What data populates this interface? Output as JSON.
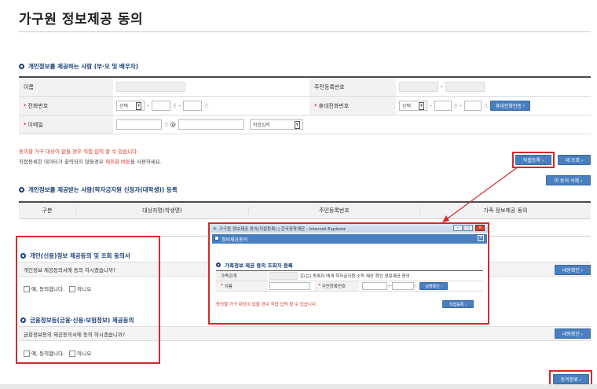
{
  "page": {
    "title": "가구원 정보제공 동의"
  },
  "provider_section": {
    "heading": "개인정보를 제공하는 사람 (부·모 및 배우자)",
    "name_label": "이름",
    "ssn_label": "주민등록번호",
    "phone_label": "전화번호",
    "mobile_label": "휴대전화번호",
    "email_label": "이메일",
    "select_placeholder": "선택",
    "email_domain_select": "직접입력",
    "mobile_auth_button": "휴대전화인증",
    "required_mark": "*"
  },
  "notices": {
    "red": "동의할 가구 대상이 없을 경우 직접 입력 할 수 있습니다.",
    "gray_pre": "직접등록한 데이터가 출력되지 않을경우 ",
    "gray_highlight": "재조회 버튼",
    "gray_post": "을 사용하세요."
  },
  "buttons": {
    "direct_register": "직접등록 ›",
    "requery": "재 조회 ›",
    "delete_consent": "미 동의 삭제 ›",
    "view_content_1": "내용확인 ›",
    "view_content_2": "내용확인 ›",
    "agree_complete": "동의완료 ›"
  },
  "receiver_section": {
    "heading": "개인정보를 제공받는 사람(학자금지원 신청자(대학생)) 등록",
    "columns": [
      "구분",
      "대상자명(학생명)",
      "주민등록번호",
      "가족 정보제공 동의"
    ]
  },
  "consent_personal": {
    "heading": "개인(신용)정보 제공동의 및 조회 동의서",
    "question": "개인정보 제공동의서에 동의 하시겠습니까?",
    "yes": "예, 동의합니다.",
    "no": "아니오"
  },
  "consent_financial": {
    "heading": "금융정보등(금융·신용·보험정보) 제공동의",
    "question": "금융정보등의 제공동의서에 동의 하시겠습니까?",
    "yes": "예, 동의합니다.",
    "no": "아니오"
  },
  "popup": {
    "window_title": "가구원 정보제공 동의(직접등록) | 한국장학재단 - Internet Explorer",
    "dialog_title": "정보제공동의",
    "heading": "가족정보 제공 동의 조회자 등록",
    "relation_label": "가족관계",
    "relation_text": "은(는) 동록자 에게 학자금지원 소득 재산 확인 정보제공 동의",
    "name_label": "이름",
    "ssn_label": "주민등록번호",
    "confirm_button": "실명확인 ›",
    "notice": "동의할 가구 대상이 없을 경우 직접 입력 할 수 있습니다.",
    "register_button": "직접등록 ›",
    "win_min": "–",
    "win_max": "□",
    "win_close": "✕"
  },
  "colors": {
    "accent_blue": "#4a7fbf",
    "highlight_red": "#d42a2a",
    "heading_navy": "#1b3f7a"
  }
}
